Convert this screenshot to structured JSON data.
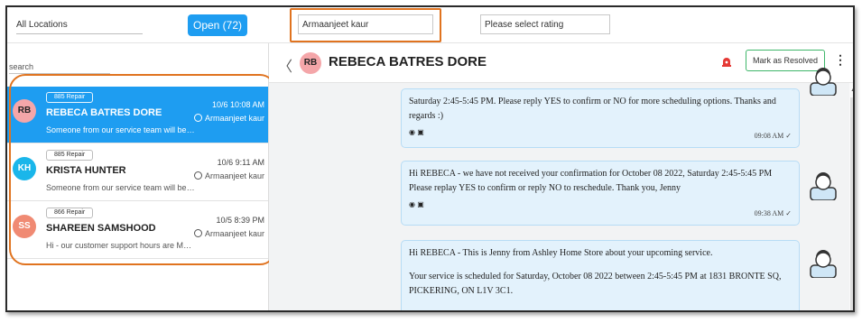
{
  "filters": {
    "location": "All Locations",
    "open_label": "Open (72)",
    "agent_value": "Armaanjeet kaur",
    "rating_placeholder": "Please select rating"
  },
  "sidebar": {
    "search_placeholder": "search",
    "conversations": [
      {
        "initials": "RB",
        "tag": "885 Repair",
        "name": "REBECA BATRES DORE",
        "time": "10/6 10:08 AM",
        "agent": "Armaanjeet kaur",
        "preview": "Someone from our service team will be i...",
        "avatar_color": "#f4a6a9"
      },
      {
        "initials": "KH",
        "tag": "885 Repair",
        "name": "KRISTA HUNTER",
        "time": "10/6 9:11 AM",
        "agent": "Armaanjeet kaur",
        "preview": "Someone from our service team will be i...",
        "avatar_color": "#1ab6ea"
      },
      {
        "initials": "SS",
        "tag": "866 Repair",
        "name": "SHAREEN SAMSHOOD",
        "time": "10/5 8:39 PM",
        "agent": "Armaanjeet kaur",
        "preview": "Hi - our customer support hours are Mon...",
        "avatar_color": "#f08a73"
      }
    ]
  },
  "chat": {
    "initials": "RB",
    "name": "REBECA BATRES DORE",
    "resolve_label": "Mark as Resolved",
    "more_glyph": "⋮",
    "back_glyph": "〈",
    "messages": [
      {
        "lines": [
          "Saturday 2:45-5:45 PM. Please reply YES to confirm or NO for more scheduling options. Thanks and",
          "regards :)"
        ],
        "time": "09:08 AM ✓"
      },
      {
        "lines": [
          "Hi REBECA - we have not received your confirmation for October 08 2022, Saturday 2:45-5:45 PM",
          "Please replay YES to confirm or reply NO to reschedule. Thank you, Jenny"
        ],
        "time": "09:38 AM ✓"
      },
      {
        "lines": [
          "Hi REBECA - This is Jenny from Ashley Home Store about your upcoming service.",
          "Your service is scheduled for Saturday, October 08 2022 between 2:45-5:45 PM at 1831 BRONTE SQ,",
          "PICKERING, ON L1V 3C1."
        ],
        "time": ""
      }
    ]
  },
  "colors": {
    "accent": "#1e9df1",
    "highlight": "#e0731f",
    "resolve_border": "#3fb66a",
    "bubble": "#e3f2fc"
  }
}
